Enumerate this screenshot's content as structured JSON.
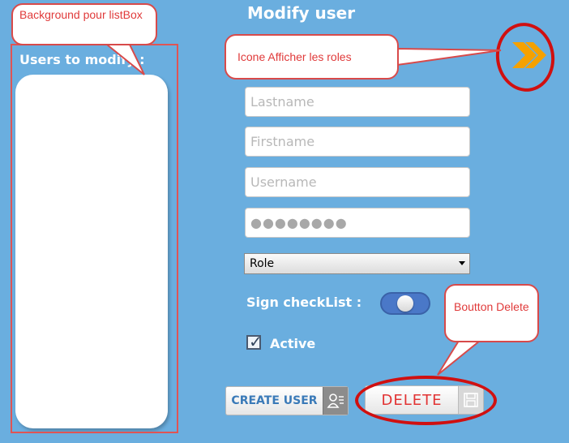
{
  "header": {
    "title": "Modify user"
  },
  "users_panel": {
    "label": "Users to modify :"
  },
  "form": {
    "lastname_placeholder": "Lastname",
    "firstname_placeholder": "Firstname",
    "username_placeholder": "Username",
    "password_value": "●●●●●●●●",
    "role_selected": "Role",
    "sign_checklist_label": "Sign checkList :",
    "sign_checklist_on": true,
    "active_label": "Active",
    "active_checked": true
  },
  "buttons": {
    "create_label": "CREATE USER",
    "delete_label": "DELETE",
    "show_roles_icon": "double-chevron-right-icon"
  },
  "annotations": {
    "listbox_background": "Background pour listBox",
    "show_roles": "Icone Afficher les roles",
    "delete_button": "Boutton Delete"
  },
  "colors": {
    "background": "#6aaedf",
    "annotation_red": "#d01010",
    "roles_icon": "#f5a100",
    "create_text": "#3a7ab8",
    "delete_text": "#e23333"
  }
}
